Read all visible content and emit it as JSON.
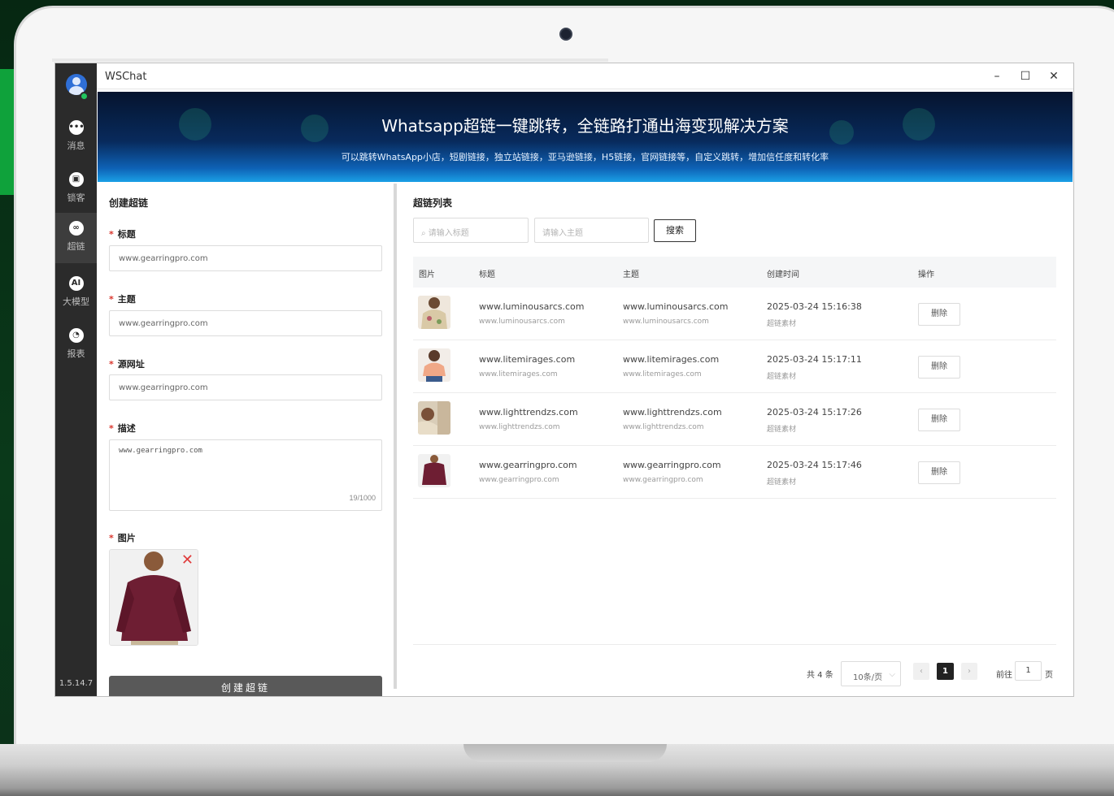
{
  "window": {
    "title": "WSChat",
    "minimize": "–",
    "maximize": "☐",
    "close": "✕"
  },
  "sidebar": {
    "items": [
      {
        "label": "消息",
        "icon": "chat-icon"
      },
      {
        "label": "锁客",
        "icon": "lock-icon"
      },
      {
        "label": "超链",
        "icon": "link-icon"
      },
      {
        "label": "大模型",
        "icon": "ai-icon"
      },
      {
        "label": "报表",
        "icon": "report-icon"
      }
    ],
    "active": "超链",
    "version": "1.5.14.7"
  },
  "banner": {
    "title": "Whatsapp超链一键跳转，全链路打通出海变现解决方案",
    "subtitle": "可以跳转WhatsApp小店，短剧链接，独立站链接，亚马逊链接，H5链接，官网链接等，自定义跳转，增加信任度和转化率"
  },
  "form": {
    "section_title": "创建超链",
    "title_label": "标题",
    "title_value": "www.gearringpro.com",
    "subject_label": "主题",
    "subject_value": "www.gearringpro.com",
    "source_label": "源网址",
    "source_value": "www.gearringpro.com",
    "desc_label": "描述",
    "desc_value": "www.gearringpro.com",
    "desc_count": "19/1000",
    "image_label": "图片",
    "submit_label": "创建超链"
  },
  "list": {
    "section_title": "超链列表",
    "title_placeholder": "请输入标题",
    "subject_placeholder": "请输入主题",
    "search_label": "搜索",
    "columns": [
      "图片",
      "标题",
      "主题",
      "创建时间",
      "操作"
    ],
    "rows": [
      {
        "title": "www.luminousarcs.com",
        "title_sub": "www.luminousarcs.com",
        "subject": "www.luminousarcs.com",
        "subject_sub": "www.luminousarcs.com",
        "time": "2025-03-24 15:16:38",
        "time_sub": "超链素材",
        "action": "删除"
      },
      {
        "title": "www.litemirages.com",
        "title_sub": "www.litemirages.com",
        "subject": "www.litemirages.com",
        "subject_sub": "www.litemirages.com",
        "time": "2025-03-24 15:17:11",
        "time_sub": "超链素材",
        "action": "删除"
      },
      {
        "title": "www.lighttrendzs.com",
        "title_sub": "www.lighttrendzs.com",
        "subject": "www.lighttrendzs.com",
        "subject_sub": "www.lighttrendzs.com",
        "time": "2025-03-24 15:17:26",
        "time_sub": "超链素材",
        "action": "删除"
      },
      {
        "title": "www.gearringpro.com",
        "title_sub": "www.gearringpro.com",
        "subject": "www.gearringpro.com",
        "subject_sub": "www.gearringpro.com",
        "time": "2025-03-24 15:17:46",
        "time_sub": "超链素材",
        "action": "删除"
      }
    ],
    "pagination": {
      "total": "共 4 条",
      "page_size": "10条/页",
      "current_page": "1",
      "goto_label": "前往",
      "goto_value": "1",
      "page_suffix": "页"
    }
  },
  "colors": {
    "accent": "#2b2b2b",
    "required": "#d9342b",
    "online": "#22c55e"
  }
}
